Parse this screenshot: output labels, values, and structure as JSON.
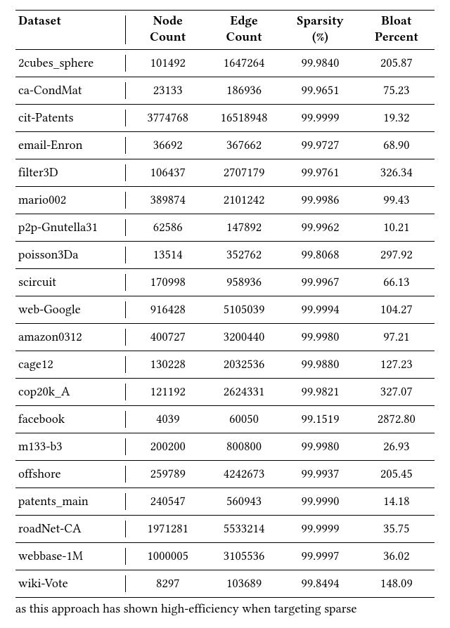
{
  "table": {
    "headers": {
      "dataset": "Dataset",
      "node_count_l1": "Node",
      "node_count_l2": "Count",
      "edge_count_l1": "Edge",
      "edge_count_l2": "Count",
      "sparsity_l1": "Sparsity",
      "sparsity_l2": "(%)",
      "bloat_l1": "Bloat",
      "bloat_l2": "Percent"
    },
    "rows": [
      {
        "dataset": "2cubes_sphere",
        "node_count": "101492",
        "edge_count": "1647264",
        "sparsity": "99.9840",
        "bloat": "205.87"
      },
      {
        "dataset": "ca-CondMat",
        "node_count": "23133",
        "edge_count": "186936",
        "sparsity": "99.9651",
        "bloat": "75.23"
      },
      {
        "dataset": "cit-Patents",
        "node_count": "3774768",
        "edge_count": "16518948",
        "sparsity": "99.9999",
        "bloat": "19.32"
      },
      {
        "dataset": "email-Enron",
        "node_count": "36692",
        "edge_count": "367662",
        "sparsity": "99.9727",
        "bloat": "68.90"
      },
      {
        "dataset": "filter3D",
        "node_count": "106437",
        "edge_count": "2707179",
        "sparsity": "99.9761",
        "bloat": "326.34"
      },
      {
        "dataset": "mario002",
        "node_count": "389874",
        "edge_count": "2101242",
        "sparsity": "99.9986",
        "bloat": "99.43"
      },
      {
        "dataset": "p2p-Gnutella31",
        "node_count": "62586",
        "edge_count": "147892",
        "sparsity": "99.9962",
        "bloat": "10.21"
      },
      {
        "dataset": "poisson3Da",
        "node_count": "13514",
        "edge_count": "352762",
        "sparsity": "99.8068",
        "bloat": "297.92"
      },
      {
        "dataset": "scircuit",
        "node_count": "170998",
        "edge_count": "958936",
        "sparsity": "99.9967",
        "bloat": "66.13"
      },
      {
        "dataset": "web-Google",
        "node_count": "916428",
        "edge_count": "5105039",
        "sparsity": "99.9994",
        "bloat": "104.27"
      },
      {
        "dataset": "amazon0312",
        "node_count": "400727",
        "edge_count": "3200440",
        "sparsity": "99.9980",
        "bloat": "97.21"
      },
      {
        "dataset": "cage12",
        "node_count": "130228",
        "edge_count": "2032536",
        "sparsity": "99.9880",
        "bloat": "127.23"
      },
      {
        "dataset": "cop20k_A",
        "node_count": "121192",
        "edge_count": "2624331",
        "sparsity": "99.9821",
        "bloat": "327.07"
      },
      {
        "dataset": "facebook",
        "node_count": "4039",
        "edge_count": "60050",
        "sparsity": "99.1519",
        "bloat": "2872.80"
      },
      {
        "dataset": "m133-b3",
        "node_count": "200200",
        "edge_count": "800800",
        "sparsity": "99.9980",
        "bloat": "26.93"
      },
      {
        "dataset": "offshore",
        "node_count": "259789",
        "edge_count": "4242673",
        "sparsity": "99.9937",
        "bloat": "205.45"
      },
      {
        "dataset": "patents_main",
        "node_count": "240547",
        "edge_count": "560943",
        "sparsity": "99.9990",
        "bloat": "14.18"
      },
      {
        "dataset": "roadNet-CA",
        "node_count": "1971281",
        "edge_count": "5533214",
        "sparsity": "99.9999",
        "bloat": "35.75"
      },
      {
        "dataset": "webbase-1M",
        "node_count": "1000005",
        "edge_count": "3105536",
        "sparsity": "99.9997",
        "bloat": "36.02"
      },
      {
        "dataset": "wiki-Vote",
        "node_count": "8297",
        "edge_count": "103689",
        "sparsity": "99.8494",
        "bloat": "148.09"
      }
    ]
  },
  "after_table_text": "as this approach has shown high-efficiency when targeting sparse"
}
